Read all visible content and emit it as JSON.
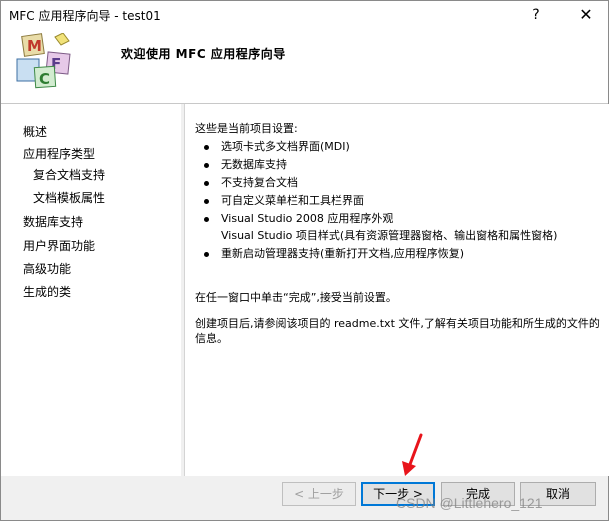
{
  "window": {
    "title": "MFC 应用程序向导 - test01",
    "help_glyph": "?",
    "close_glyph": "✕"
  },
  "header": {
    "heading": "欢迎使用 MFC 应用程序向导",
    "logo_letters": [
      "M",
      "F",
      "C"
    ]
  },
  "nav": {
    "items": [
      {
        "label": "概述"
      },
      {
        "label": "应用程序类型"
      },
      {
        "label": "复合文档支持"
      },
      {
        "label": "文档模板属性"
      },
      {
        "label": "数据库支持"
      },
      {
        "label": "用户界面功能"
      },
      {
        "label": "高级功能"
      },
      {
        "label": "生成的类"
      }
    ]
  },
  "content": {
    "intro": "这些是当前项目设置:",
    "bullets": [
      "选项卡式多文档界面(MDI)",
      "无数据库支持",
      "不支持复合文档",
      "可自定义菜单栏和工具栏界面",
      "Visual Studio 2008 应用程序外观",
      "Visual Studio 项目样式(具有资源管理器窗格、输出窗格和属性窗格)",
      "重新启动管理器支持(重新打开文档,应用程序恢复)"
    ],
    "finish_note": "在任一窗口中单击“完成”,接受当前设置。",
    "readme_note": "创建项目后,请参阅该项目的 readme.txt 文件,了解有关项目功能和所生成的文件的信息。"
  },
  "buttons": {
    "prev": "< 上一步",
    "next": "下一步 >",
    "finish": "完成",
    "cancel": "取消"
  },
  "watermark": "CSDN @Littlehero_121",
  "colors": {
    "focus_border": "#0078d7",
    "annotation_arrow": "#e8141b"
  }
}
